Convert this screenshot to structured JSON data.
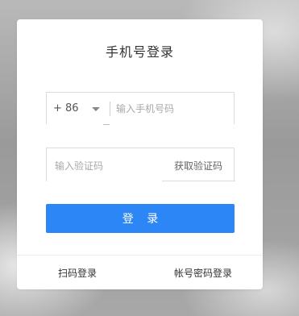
{
  "login": {
    "title": "手机号登录",
    "country_code": "+ 86",
    "phone_placeholder": "输入手机号码",
    "code_placeholder": "输入验证码",
    "get_code_label": "获取验证码",
    "submit_label": "登 录"
  },
  "footer": {
    "qr_login": "扫码登录",
    "account_login": "帐号密码登录"
  },
  "colors": {
    "primary": "#2d86f5"
  }
}
